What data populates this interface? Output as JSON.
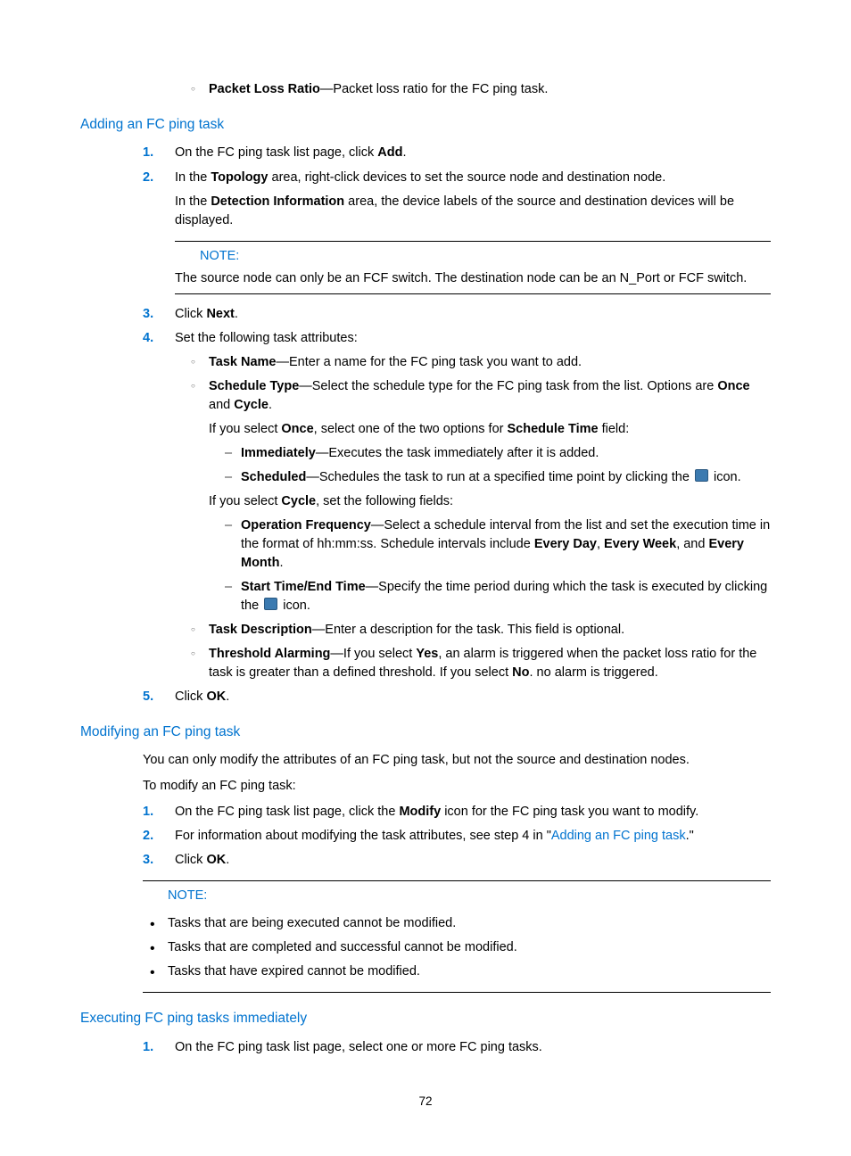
{
  "top_item": {
    "term": "Packet Loss Ratio",
    "desc": "—Packet loss ratio for the FC ping task."
  },
  "h_add": "Adding an FC ping task",
  "add_steps": {
    "s1": {
      "n": "1.",
      "pre": "On the FC ping task list page, click ",
      "b": "Add",
      "post": "."
    },
    "s2": {
      "n": "2.",
      "p1_pre": "In the ",
      "p1_b": "Topology",
      "p1_post": " area, right-click devices to set the source node and destination node.",
      "p2_pre": "In the ",
      "p2_b": "Detection Information",
      "p2_post": " area, the device labels of the source and destination devices will be displayed.",
      "note_label": "NOTE:",
      "note_body": "The source node can only be an FCF switch. The destination node can be an N_Port or FCF switch."
    },
    "s3": {
      "n": "3.",
      "pre": "Click ",
      "b": "Next",
      "post": "."
    },
    "s4": {
      "n": "4.",
      "intro": "Set the following task attributes:",
      "taskname": {
        "b": "Task Name",
        "post": "—Enter a name for the FC ping task you want to add."
      },
      "schedtype": {
        "b": "Schedule Type",
        "post_a": "—Select the schedule type for the FC ping task from the list. Options are ",
        "b2": "Once",
        "mid": " and ",
        "b3": "Cycle",
        "post_b": ".",
        "once_pre": "If you select ",
        "once_b": "Once",
        "once_mid": ", select one of the two options for ",
        "once_b2": "Schedule Time",
        "once_post": " field:",
        "imm": {
          "b": "Immediately",
          "post": "—Executes the task immediately after it is added."
        },
        "sch": {
          "b": "Scheduled",
          "post": "—Schedules the task to run at a specified time point by clicking the ",
          "icon_post": " icon."
        },
        "cycle_pre": "If you select ",
        "cycle_b": "Cycle",
        "cycle_post": ", set the following fields:",
        "opfreq": {
          "b": "Operation Frequency",
          "post_a": "—Select a schedule interval from the list and set the execution time in the format of hh:mm:ss. Schedule intervals include ",
          "b1": "Every Day",
          "m1": ", ",
          "b2": "Every Week",
          "m2": ", and ",
          "b3": "Every Month",
          "post_b": "."
        },
        "startend": {
          "b": "Start Time/End Time",
          "post": "—Specify the time period during which the task is executed by clicking the ",
          "icon_post": " icon."
        }
      },
      "taskdesc": {
        "b": "Task Description",
        "post": "—Enter a description for the task. This field is optional."
      },
      "thresh": {
        "b": "Threshold Alarming",
        "a": "—If you select ",
        "b1": "Yes",
        "c": ", an alarm is triggered when the packet loss ratio for the task is greater than a defined threshold. If you select ",
        "b2": "No",
        "d": ". no alarm is triggered."
      }
    },
    "s5": {
      "n": "5.",
      "pre": "Click ",
      "b": "OK",
      "post": "."
    }
  },
  "h_mod": "Modifying an FC ping task",
  "mod_intro1": "You can only modify the attributes of an FC ping task, but not the source and destination nodes.",
  "mod_intro2": "To modify an FC ping task:",
  "mod_steps": {
    "s1": {
      "n": "1.",
      "pre": "On the FC ping task list page, click the ",
      "b": "Modify",
      "post": " icon for the FC ping task you want to modify."
    },
    "s2": {
      "n": "2.",
      "pre": "For information about modifying the task attributes, see step 4 in \"",
      "link": "Adding an FC ping task",
      "post": ".\""
    },
    "s3": {
      "n": "3.",
      "pre": "Click ",
      "b": "OK",
      "post": "."
    }
  },
  "mod_note_label": "NOTE:",
  "mod_note_items": {
    "a": "Tasks that are being executed cannot be modified.",
    "b": "Tasks that are completed and successful cannot be modified.",
    "c": "Tasks that have expired cannot be modified."
  },
  "h_exec": "Executing FC ping tasks immediately",
  "exec_steps": {
    "s1": {
      "n": "1.",
      "text": "On the FC ping task list page, select one or more FC ping tasks."
    }
  },
  "page_number": "72"
}
